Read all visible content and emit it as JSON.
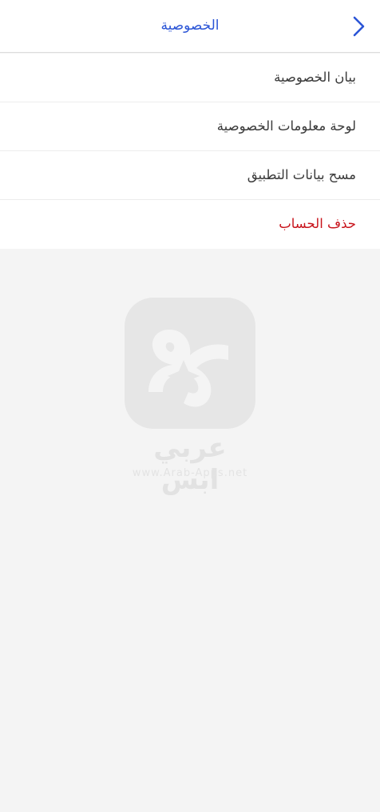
{
  "header": {
    "title": "الخصوصية",
    "back_icon": "chevron-right-icon",
    "accent_color": "#2b55d6"
  },
  "menu": {
    "items": [
      {
        "label": "بيان الخصوصية",
        "name": "privacy-statement"
      },
      {
        "label": "لوحة معلومات الخصوصية",
        "name": "privacy-dashboard"
      },
      {
        "label": "مسح بيانات التطبيق",
        "name": "clear-app-data"
      },
      {
        "label": "حذف الحساب",
        "name": "delete-account",
        "color": "#c8131b"
      }
    ]
  },
  "watermark": {
    "arabic_text": "عربي ابس",
    "url": "www.Arab-Apps.net",
    "logo_icon": "arab-apps-logo-icon"
  }
}
